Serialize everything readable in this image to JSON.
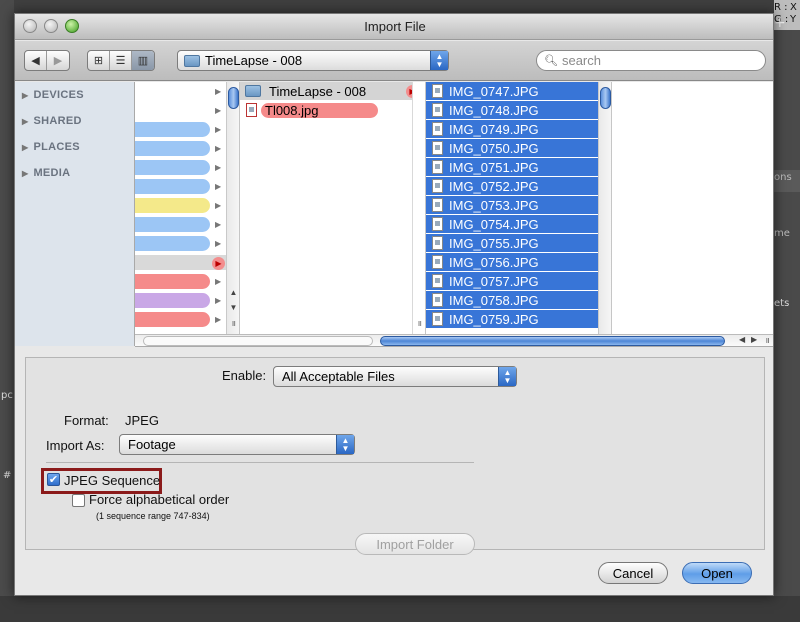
{
  "dialog": {
    "title": "Import File"
  },
  "toolbar": {
    "location": "TimeLapse - 008",
    "search_placeholder": "search",
    "view_icons": [
      "icon-view-icon",
      "list-view-icon",
      "column-view-icon"
    ]
  },
  "sidebar": {
    "items": [
      "DEVICES",
      "SHARED",
      "PLACES",
      "MEDIA"
    ]
  },
  "column2": {
    "items": [
      {
        "name": "TimeLapse - 008",
        "type": "folder",
        "selected": true
      },
      {
        "name": "Tl008.jpg",
        "type": "image",
        "label_color": "#f58a8a"
      }
    ]
  },
  "column3": {
    "items": [
      "IMG_0747.JPG",
      "IMG_0748.JPG",
      "IMG_0749.JPG",
      "IMG_0750.JPG",
      "IMG_0751.JPG",
      "IMG_0752.JPG",
      "IMG_0753.JPG",
      "IMG_0754.JPG",
      "IMG_0755.JPG",
      "IMG_0756.JPG",
      "IMG_0757.JPG",
      "IMG_0758.JPG",
      "IMG_0759.JPG"
    ]
  },
  "options": {
    "enable_label": "Enable:",
    "enable_value": "All Acceptable Files",
    "format_label": "Format:",
    "format_value": "JPEG",
    "import_as_label": "Import As:",
    "import_as_value": "Footage",
    "jpeg_sequence_label": "JPEG Sequence",
    "jpeg_sequence_checked": true,
    "force_alpha_label": "Force alphabetical order",
    "force_alpha_checked": false,
    "sequence_range_note": "(1 sequence range 747-834)",
    "import_folder_label": "Import Folder"
  },
  "buttons": {
    "cancel": "Cancel",
    "open": "Open"
  },
  "background": {
    "right_texts": [
      "R :",
      "G :",
      "X",
      "Y",
      "+",
      "ons",
      "me",
      "ets"
    ],
    "left_texts": [
      "pc",
      "#"
    ]
  },
  "colors": {
    "selection": "#3875d7",
    "highlight_box": "#8b1a1a",
    "label_blue": "#9cc6f5",
    "label_yellow": "#f4e98a",
    "label_red": "#f58a8a",
    "label_purple": "#c9a7e6",
    "label_gray": "#d9d9d9"
  }
}
